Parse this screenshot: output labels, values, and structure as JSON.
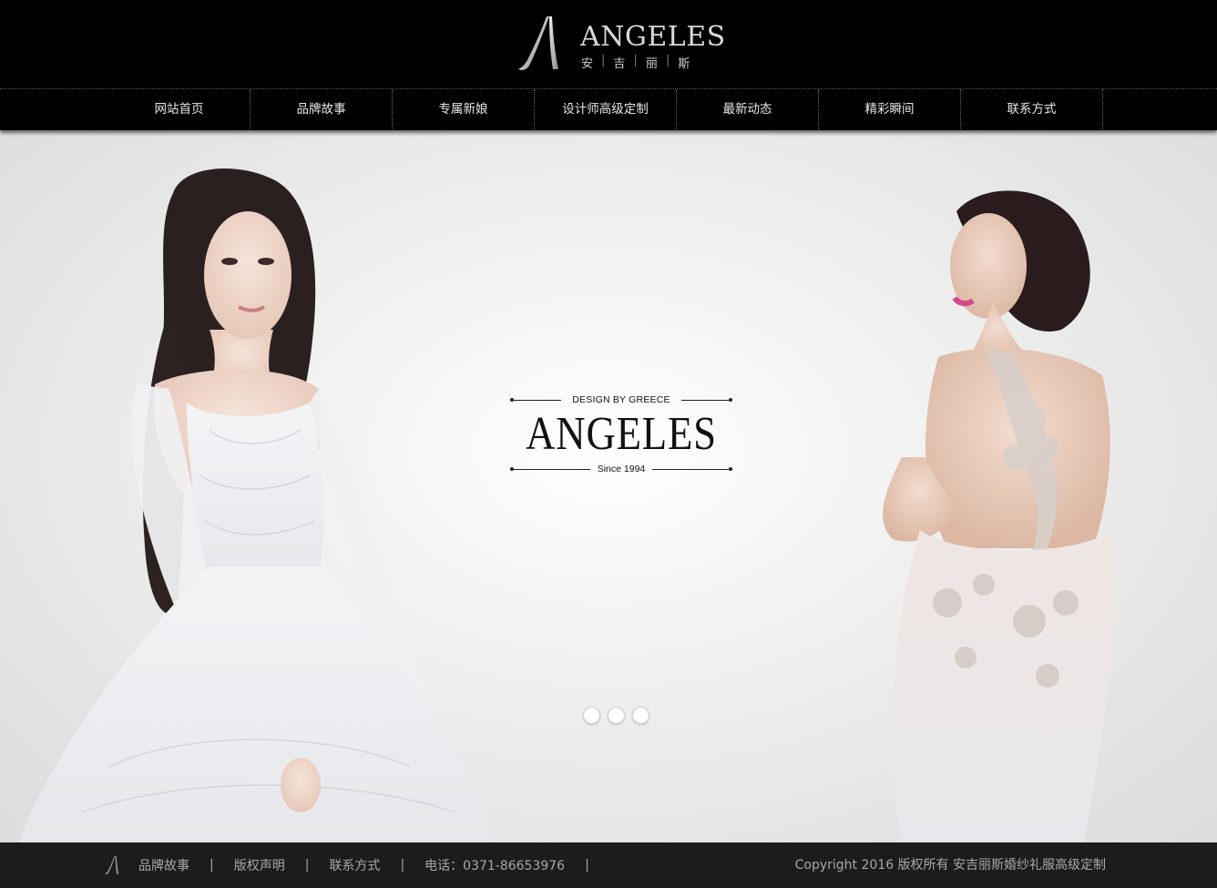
{
  "header": {
    "logo_word": "ANGELES",
    "logo_sub": [
      "安",
      "吉",
      "丽",
      "斯"
    ]
  },
  "nav": {
    "items": [
      "网站首页",
      "品牌故事",
      "专属新娘",
      "设计师高级定制",
      "最新动态",
      "精彩瞬间",
      "联系方式"
    ]
  },
  "banner": {
    "badge_top": "DESIGN BY GREECE",
    "badge_title": "ANGELES",
    "badge_bottom": "Since 1994",
    "slide_count": 3
  },
  "footer": {
    "links": [
      "品牌故事",
      "版权声明",
      "联系方式"
    ],
    "separator": "|",
    "phone": "电话：0371-86653976",
    "copyright": "Copyright 2016 版权所有 安吉丽斯婚纱礼服高级定制"
  },
  "colors": {
    "header_bg": "#000000",
    "footer_bg": "#1c1c1c",
    "footer_text": "#a8a8a8",
    "banner_bg": "#ececec"
  }
}
